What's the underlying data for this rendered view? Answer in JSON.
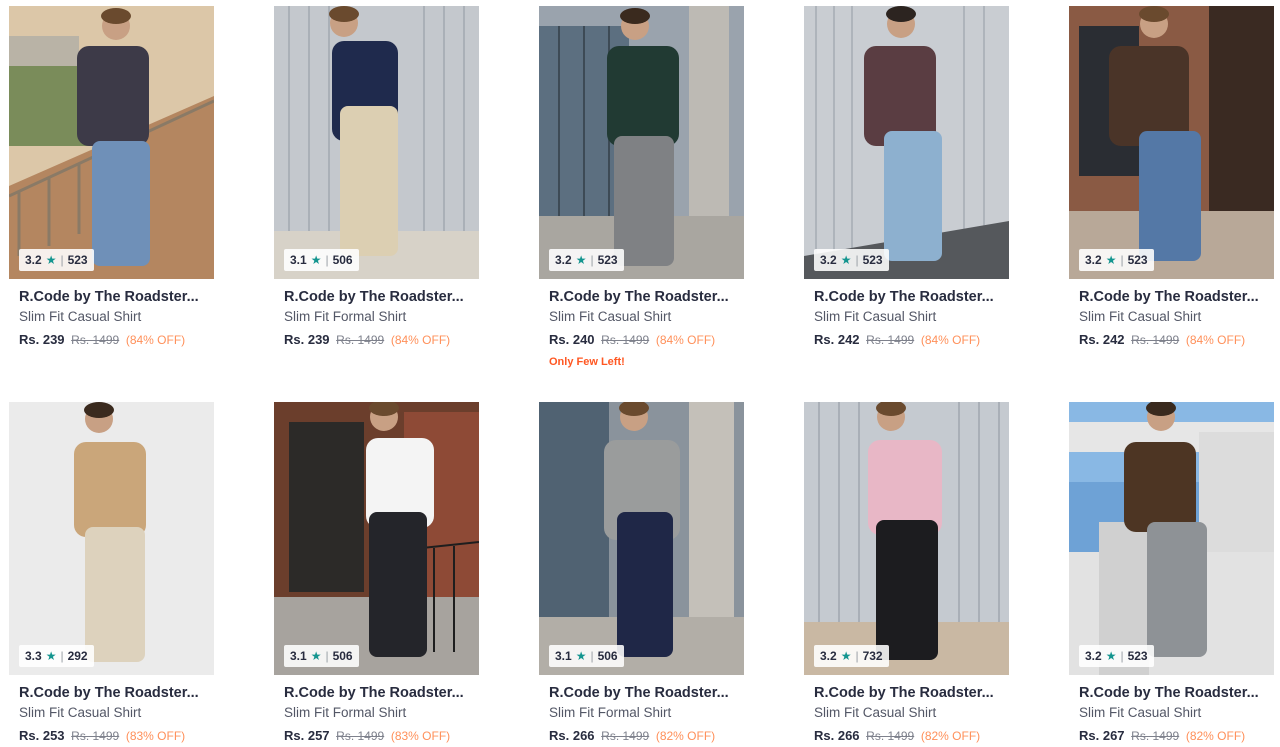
{
  "colors": {
    "rating_star": "#14958f",
    "discount": "#ff905a",
    "low_stock": "#ff5722"
  },
  "products": [
    {
      "brand": "R.Code by The Roadster...",
      "desc": "Slim Fit Casual Shirt",
      "price": "Rs. 239",
      "mrp": "Rs. 1499",
      "discount": "(84% OFF)",
      "rating": "3.2",
      "count": "523",
      "stock": ""
    },
    {
      "brand": "R.Code by The Roadster...",
      "desc": "Slim Fit Formal Shirt",
      "price": "Rs. 239",
      "mrp": "Rs. 1499",
      "discount": "(84% OFF)",
      "rating": "3.1",
      "count": "506",
      "stock": ""
    },
    {
      "brand": "R.Code by The Roadster...",
      "desc": "Slim Fit Casual Shirt",
      "price": "Rs. 240",
      "mrp": "Rs. 1499",
      "discount": "(84% OFF)",
      "rating": "3.2",
      "count": "523",
      "stock": "Only Few Left!"
    },
    {
      "brand": "R.Code by The Roadster...",
      "desc": "Slim Fit Casual Shirt",
      "price": "Rs. 242",
      "mrp": "Rs. 1499",
      "discount": "(84% OFF)",
      "rating": "3.2",
      "count": "523",
      "stock": ""
    },
    {
      "brand": "R.Code by The Roadster...",
      "desc": "Slim Fit Casual Shirt",
      "price": "Rs. 242",
      "mrp": "Rs. 1499",
      "discount": "(84% OFF)",
      "rating": "3.2",
      "count": "523",
      "stock": ""
    },
    {
      "brand": "R.Code by The Roadster...",
      "desc": "Slim Fit Casual Shirt",
      "price": "Rs. 253",
      "mrp": "Rs. 1499",
      "discount": "(83% OFF)",
      "rating": "3.3",
      "count": "292",
      "stock": ""
    },
    {
      "brand": "R.Code by The Roadster...",
      "desc": "Slim Fit Formal Shirt",
      "price": "Rs. 257",
      "mrp": "Rs. 1499",
      "discount": "(83% OFF)",
      "rating": "3.1",
      "count": "506",
      "stock": ""
    },
    {
      "brand": "R.Code by The Roadster...",
      "desc": "Slim Fit Formal Shirt",
      "price": "Rs. 266",
      "mrp": "Rs. 1499",
      "discount": "(82% OFF)",
      "rating": "3.1",
      "count": "506",
      "stock": ""
    },
    {
      "brand": "R.Code by The Roadster...",
      "desc": "Slim Fit Casual Shirt",
      "price": "Rs. 266",
      "mrp": "Rs. 1499",
      "discount": "(82% OFF)",
      "rating": "3.2",
      "count": "732",
      "stock": ""
    },
    {
      "brand": "R.Code by The Roadster...",
      "desc": "Slim Fit Casual Shirt",
      "price": "Rs. 267",
      "mrp": "Rs. 1499",
      "discount": "(82% OFF)",
      "rating": "3.2",
      "count": "523",
      "stock": ""
    }
  ]
}
